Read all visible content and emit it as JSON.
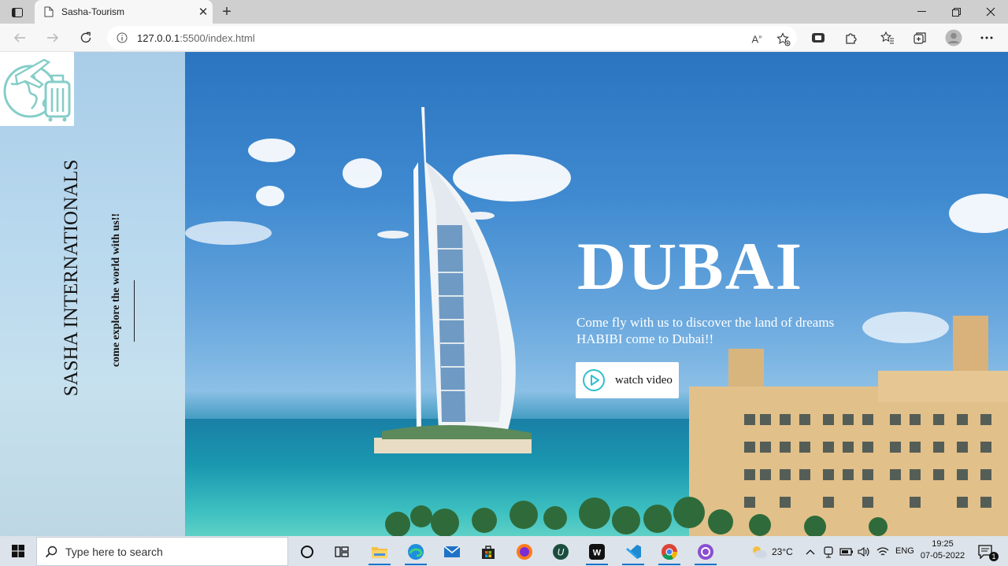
{
  "browser": {
    "tab_title": "Sasha-Tourism",
    "url_host": "127.0.0.1",
    "url_rest": ":5500/index.html"
  },
  "sidebar": {
    "brand_name": "SASHA INTERNATIONALS",
    "tagline": "come explore the world with us!!"
  },
  "hero": {
    "title": "DUBAI",
    "subtitle_line1": "Come fly with us to discover the land of dreams",
    "subtitle_line2": "HABIBI come to Dubai!!",
    "watch_label": "watch video"
  },
  "taskbar": {
    "search_placeholder": "Type here to search",
    "temperature": "23°C",
    "language": "ENG",
    "time": "19:25",
    "date": "07-05-2022",
    "notification_count": "1"
  },
  "colors": {
    "accent": "#1a73c9",
    "play_icon": "#2fbfd0"
  }
}
